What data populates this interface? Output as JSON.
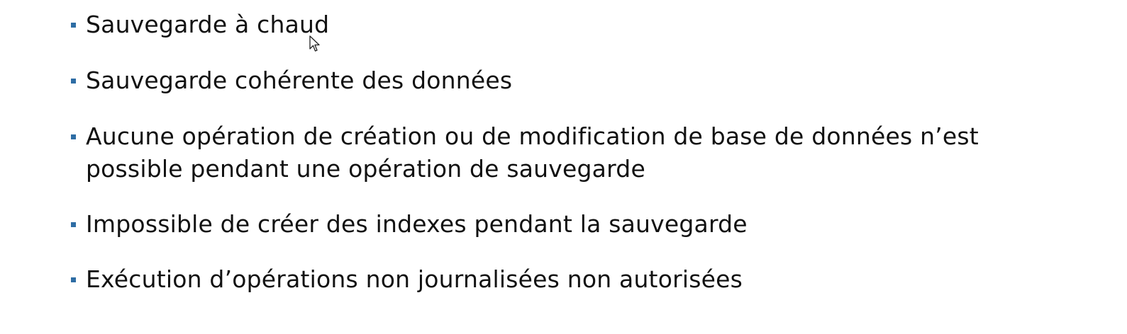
{
  "slide": {
    "accent_color": "#2e6da4",
    "bullets": [
      {
        "text": "Sauvegarde à chaud"
      },
      {
        "text": "Sauvegarde cohérente des données"
      },
      {
        "text": "Aucune opération de création ou de modification de base de données n’est\npossible pendant une opération de sauvegarde"
      },
      {
        "text": "Impossible de créer des indexes pendant la sauvegarde"
      },
      {
        "text": "Exécution d’opérations non journalisées non autorisées"
      }
    ],
    "cursor_icon": "mouse-pointer-icon"
  }
}
